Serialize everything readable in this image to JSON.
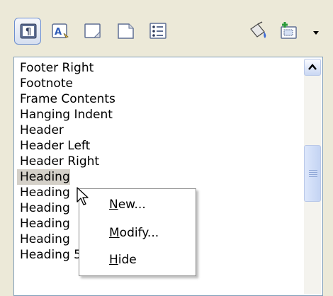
{
  "toolbar": {
    "buttons": [
      {
        "name": "paragraph-styles",
        "icon": "paragraph-styles-icon",
        "active": true
      },
      {
        "name": "character-styles",
        "icon": "character-styles-icon",
        "active": false
      },
      {
        "name": "frame-styles",
        "icon": "frame-styles-icon",
        "active": false
      },
      {
        "name": "page-styles",
        "icon": "page-styles-icon",
        "active": false
      },
      {
        "name": "list-styles",
        "icon": "list-styles-icon",
        "active": false
      },
      {
        "name": "fill-format-mode",
        "icon": "paint-bucket-icon",
        "active": false
      },
      {
        "name": "new-style-from-selection",
        "icon": "new-style-icon",
        "active": false
      }
    ]
  },
  "styles_list": {
    "items": [
      {
        "label": "Footer Right",
        "selected": false
      },
      {
        "label": "Footnote",
        "selected": false
      },
      {
        "label": "Frame Contents",
        "selected": false
      },
      {
        "label": "Hanging Indent",
        "selected": false
      },
      {
        "label": "Header",
        "selected": false
      },
      {
        "label": "Header Left",
        "selected": false
      },
      {
        "label": "Header Right",
        "selected": false
      },
      {
        "label": "Heading",
        "selected": true
      },
      {
        "label": "Heading",
        "selected": false
      },
      {
        "label": "Heading",
        "selected": false
      },
      {
        "label": "Heading",
        "selected": false
      },
      {
        "label": "Heading",
        "selected": false
      },
      {
        "label": "Heading 5",
        "selected": false
      }
    ]
  },
  "context_menu": {
    "new": {
      "mnemonic": "N",
      "rest": "ew..."
    },
    "modify": {
      "mnemonic": "M",
      "rest": "odify..."
    },
    "hide": {
      "mnemonic": "H",
      "rest": "ide"
    }
  },
  "colors": {
    "panel": "#ece9d8",
    "list_border": "#7f9db9",
    "selected_row": "#d4d0c8",
    "accent": "#6d8fd0"
  }
}
